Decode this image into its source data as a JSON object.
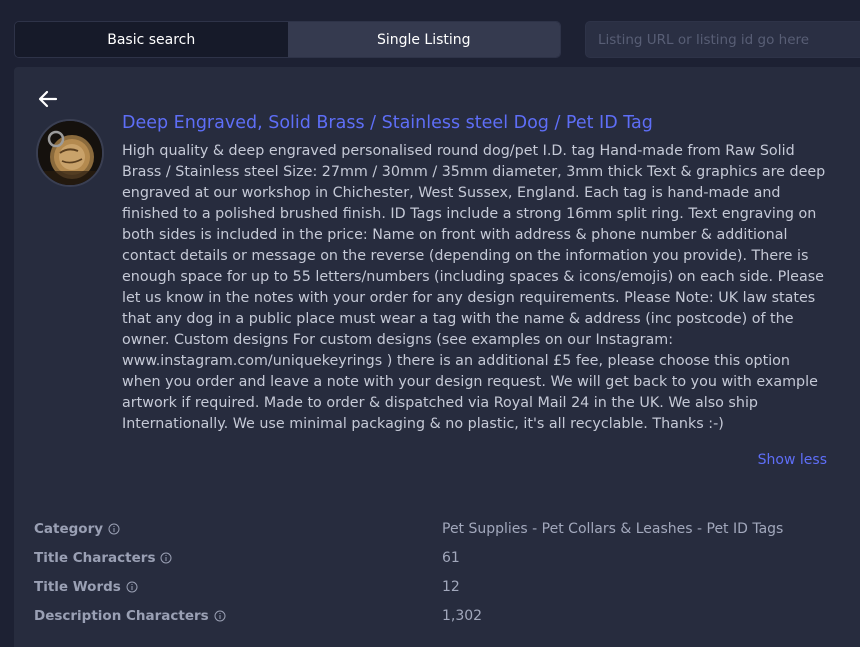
{
  "tabs": {
    "basic_search": "Basic search",
    "single_listing": "Single Listing"
  },
  "search": {
    "placeholder": "Listing URL or listing id go here"
  },
  "listing": {
    "title": "Deep Engraved, Solid Brass / Stainless steel Dog / Pet ID Tag",
    "description": "High quality & deep engraved personalised round dog/pet I.D. tag Hand-made from Raw Solid Brass / Stainless steel Size: 27mm / 30mm / 35mm diameter, 3mm thick Text & graphics are deep engraved at our workshop in Chichester, West Sussex, England. Each tag is hand-made and finished to a polished brushed finish. ID Tags include a strong 16mm split ring. Text engraving on both sides is included in the price: Name on front with address & phone number & additional contact details or message on the reverse (depending on the information you provide). There is enough space for up to 55 letters/numbers (including spaces & icons/emojis) on each side. Please let us know in the notes with your order for any design requirements. Please Note: UK law states that any dog in a public place must wear a tag with the name & address (inc postcode) of the owner. Custom designs For custom designs (see examples on our Instagram: www.instagram.com/uniquekeyrings ) there is an additional £5 fee, please choose this option when you order and leave a note with your design request. We will get back to you with example artwork if required. Made to order & dispatched via Royal Mail 24 in the UK. We also ship Internationally. We use minimal packaging & no plastic, it's all recyclable. Thanks :-)",
    "show_less": "Show less",
    "thumbnail_icon": "pet-tag-thumbnail"
  },
  "stats": [
    {
      "label": "Category",
      "value": "Pet Supplies - Pet Collars & Leashes - Pet ID Tags"
    },
    {
      "label": "Title Characters",
      "value": "61"
    },
    {
      "label": "Title Words",
      "value": "12"
    },
    {
      "label": "Description Characters",
      "value": "1,302"
    }
  ],
  "colors": {
    "background": "#1d2133",
    "card": "#272c3e",
    "accent": "#5e6ef7",
    "text": "#c5c9d6"
  }
}
